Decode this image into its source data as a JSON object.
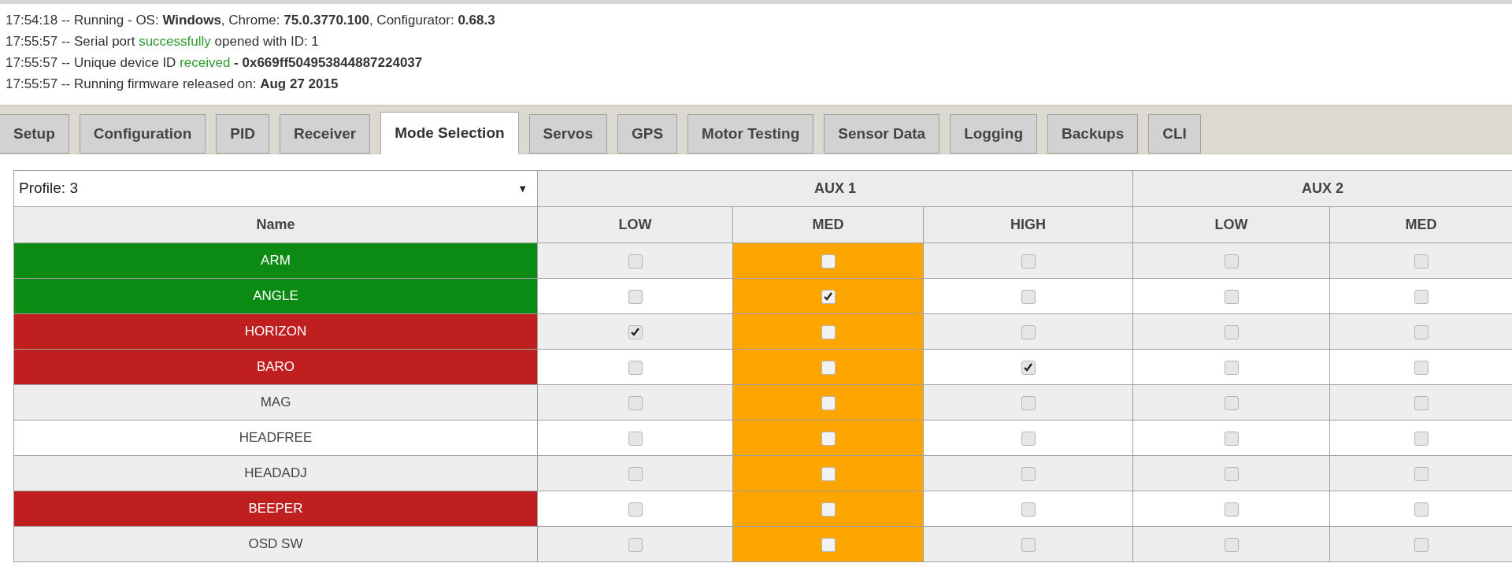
{
  "log": [
    [
      {
        "text": "17:54:18 -- Running - OS: ",
        "kind": "plain"
      },
      {
        "text": "Windows",
        "kind": "bold"
      },
      {
        "text": ", Chrome: ",
        "kind": "plain"
      },
      {
        "text": "75.0.3770.100",
        "kind": "bold"
      },
      {
        "text": ", Configurator: ",
        "kind": "plain"
      },
      {
        "text": "0.68.3",
        "kind": "bold"
      }
    ],
    [
      {
        "text": "17:55:57 -- Serial port ",
        "kind": "plain"
      },
      {
        "text": "successfully",
        "kind": "green"
      },
      {
        "text": " opened with ID: 1",
        "kind": "plain"
      }
    ],
    [
      {
        "text": "17:55:57 -- Unique device ID ",
        "kind": "plain"
      },
      {
        "text": "received",
        "kind": "green"
      },
      {
        "text": " - 0x669ff504953844887224037",
        "kind": "bold"
      }
    ],
    [
      {
        "text": "17:55:57 -- Running firmware released on: ",
        "kind": "plain"
      },
      {
        "text": "Aug 27 2015",
        "kind": "bold"
      }
    ]
  ],
  "tabs": [
    {
      "label": "Setup",
      "selected": false
    },
    {
      "label": "Configuration",
      "selected": false
    },
    {
      "label": "PID",
      "selected": false
    },
    {
      "label": "Receiver",
      "selected": false
    },
    {
      "label": "Mode Selection",
      "selected": true
    },
    {
      "label": "Servos",
      "selected": false
    },
    {
      "label": "GPS",
      "selected": false
    },
    {
      "label": "Motor Testing",
      "selected": false
    },
    {
      "label": "Sensor Data",
      "selected": false
    },
    {
      "label": "Logging",
      "selected": false
    },
    {
      "label": "Backups",
      "selected": false
    },
    {
      "label": "CLI",
      "selected": false
    }
  ],
  "profile_select": {
    "value": "Profile: 3",
    "caret": "▼"
  },
  "table": {
    "name_header": "Name",
    "groups": [
      {
        "label": "AUX 1",
        "columns": [
          {
            "label": "LOW",
            "highlighted": false
          },
          {
            "label": "MED",
            "highlighted": true
          },
          {
            "label": "HIGH",
            "highlighted": false
          }
        ]
      },
      {
        "label": "AUX 2",
        "columns": [
          {
            "label": "LOW",
            "highlighted": false
          },
          {
            "label": "MED",
            "highlighted": false
          }
        ]
      }
    ],
    "rows": [
      {
        "name": "ARM",
        "color": "#0b8a14",
        "checked": [
          false,
          false,
          false,
          false,
          false
        ]
      },
      {
        "name": "ANGLE",
        "color": "#0b8a14",
        "checked": [
          false,
          true,
          false,
          false,
          false
        ]
      },
      {
        "name": "HORIZON",
        "color": "#bf1f1f",
        "checked": [
          true,
          false,
          false,
          false,
          false
        ]
      },
      {
        "name": "BARO",
        "color": "#bf1f1f",
        "checked": [
          false,
          false,
          true,
          false,
          false
        ]
      },
      {
        "name": "MAG",
        "checked": [
          false,
          false,
          false,
          false,
          false
        ]
      },
      {
        "name": "HEADFREE",
        "checked": [
          false,
          false,
          false,
          false,
          false
        ]
      },
      {
        "name": "HEADADJ",
        "checked": [
          false,
          false,
          false,
          false,
          false
        ]
      },
      {
        "name": "BEEPER",
        "color": "#bf1f1f",
        "checked": [
          false,
          false,
          false,
          false,
          false
        ]
      },
      {
        "name": "OSD SW",
        "checked": [
          false,
          false,
          false,
          false,
          false
        ]
      }
    ]
  }
}
